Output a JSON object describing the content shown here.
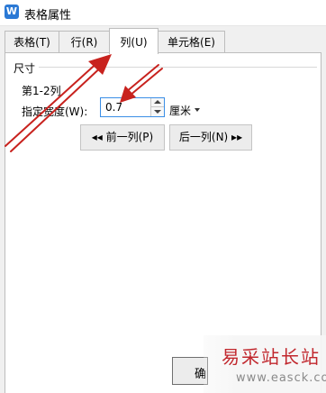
{
  "window": {
    "title": "表格属性",
    "app_icon": "W"
  },
  "tabs": [
    {
      "label": "表格(T)"
    },
    {
      "label": "行(R)"
    },
    {
      "label": "列(U)",
      "active": true
    },
    {
      "label": "单元格(E)"
    }
  ],
  "size_group": {
    "title": "尺寸",
    "column_range": "第1-2列",
    "width_label": "指定宽度(W):",
    "width_value": "0.7",
    "unit": "厘米"
  },
  "buttons": {
    "prev": "◂◂ 前一列(P)",
    "next": "后一列(N) ▸▸",
    "ok_partial": "确"
  },
  "watermark": {
    "text": "易采站长站",
    "url": "www.easck.com"
  },
  "colors": {
    "annotation": "#c8221e",
    "focus_border": "#3a8ee6",
    "watermark": "#c1272d"
  }
}
